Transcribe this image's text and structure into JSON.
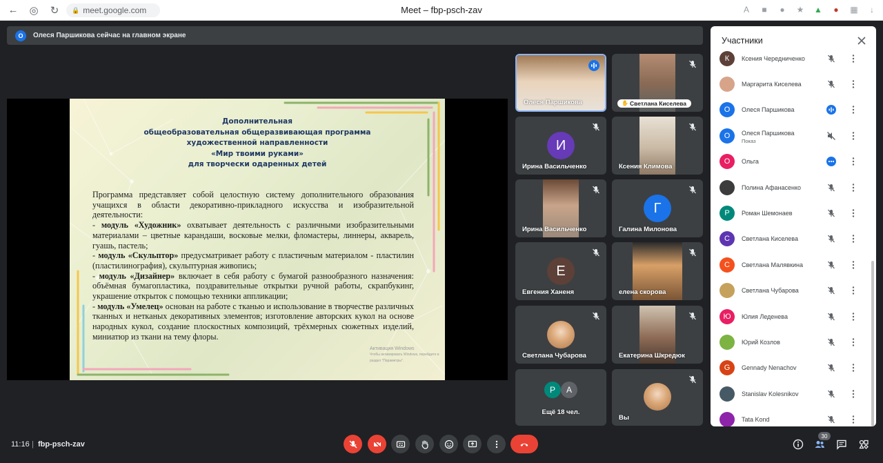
{
  "browser": {
    "url": "meet.google.com",
    "tab_title": "Meet – fbp-psch-zav"
  },
  "banner": {
    "avatar_letter": "О",
    "text": "Олеся Паршикова сейчас на главном экране"
  },
  "slide": {
    "heading_lines": [
      "Дополнительная",
      "общеобразовательная общеразвивающая программа",
      "художественной направленности",
      "«Мир твоими руками»",
      "для творчески одаренных детей"
    ],
    "intro": "Программа представляет собой целостную систему дополнительного образования учащихся в области декоративно-прикладного искусства и изобразительной деятельности:",
    "modules": [
      {
        "lead": "- ",
        "title": "модуль «Художник»",
        "text": " охватывает деятельность с различными изобразительными материалами – цветные карандаши, восковые мелки, фломастеры, линнеры, акварель, гуашь, пастель;"
      },
      {
        "lead": "- ",
        "title": "модуль «Скульптор»",
        "text": " предусматривает работу с пластичным материалом - пластилин (пластилинография), скульптурная живопись;"
      },
      {
        "lead": "- ",
        "title": "модуль «Дизайнер»",
        "text": " включает в себя работу с бумагой разнообразного назначения: объёмная бумагопластика, поздравительные открытки ручной работы, скрапбукинг, украшение открыток с помощью техники аппликации;"
      },
      {
        "lead": "- ",
        "title": "модуль «Умелец»",
        "text": " основан на работе с тканью и использование в творчестве различных тканных и нетканых декоративных элементов; изготовление авторских кукол на основе народных кукол, создание плоскостных композиций, трёхмерных сюжетных изделий, миниатюр из ткани на тему флоры."
      }
    ],
    "watermark_title": "Активация Windows",
    "watermark_sub": "Чтобы активировать Windows, перейдите в раздел \"Параметры\"."
  },
  "tiles": [
    {
      "name": "Олеся Паршикова",
      "kind": "photo",
      "active": true,
      "speaking": true
    },
    {
      "name": "Светлана Киселева",
      "kind": "photo",
      "muted": true,
      "pill": true
    },
    {
      "name": "Ирина Васильченко",
      "kind": "avatar",
      "letter": "И",
      "color": "#673ab7",
      "muted": true
    },
    {
      "name": "Ксения Климова",
      "kind": "photo",
      "muted": true
    },
    {
      "name": "Ирина Васильченко",
      "kind": "photo",
      "muted": true
    },
    {
      "name": "Галина Милонова",
      "kind": "avatar",
      "letter": "Г",
      "color": "#1a73e8",
      "muted": true
    },
    {
      "name": "Евгения Ханеня",
      "kind": "avatar",
      "letter": "Е",
      "color": "#5d4037",
      "muted": true
    },
    {
      "name": "елена скорова",
      "kind": "photo",
      "muted": true
    },
    {
      "name": "Светлана Чубарова",
      "kind": "photo-round",
      "muted": true
    },
    {
      "name": "Екатерина Шкредюк",
      "kind": "photo",
      "muted": true
    },
    {
      "name": "Ещё 18 чел.",
      "kind": "more",
      "letters": [
        "Р",
        "А"
      ]
    },
    {
      "name": "Вы",
      "kind": "photo-round",
      "muted": true
    }
  ],
  "panel": {
    "title": "Участники",
    "participants": [
      {
        "name": "Ксения Чередниченко",
        "letter": "К",
        "color": "#5d4037",
        "status": "muted"
      },
      {
        "name": "Маргарита Киселева",
        "letter": "",
        "color": "#d7a48a",
        "status": "muted"
      },
      {
        "name": "Олеся Паршикова",
        "letter": "О",
        "color": "#1a73e8",
        "status": "speaking"
      },
      {
        "name": "Олеся Паршикова",
        "sub": "Показ",
        "letter": "О",
        "color": "#1a73e8",
        "status": "presenting"
      },
      {
        "name": "Ольга",
        "letter": "О",
        "color": "#e91e63",
        "status": "more"
      },
      {
        "name": "Полина Афанасенко",
        "letter": "",
        "color": "#3c3c3c",
        "status": "muted"
      },
      {
        "name": "Роман Шемонаев",
        "letter": "Р",
        "color": "#00897b",
        "status": "muted"
      },
      {
        "name": "Светлана Киселева",
        "letter": "С",
        "color": "#5e35b1",
        "status": "muted"
      },
      {
        "name": "Светлана Малявкина",
        "letter": "С",
        "color": "#f4511e",
        "status": "muted"
      },
      {
        "name": "Светлана Чубарова",
        "letter": "",
        "color": "#c6a15b",
        "status": "muted"
      },
      {
        "name": "Юлия Леденева",
        "letter": "Ю",
        "color": "#e91e63",
        "status": "muted"
      },
      {
        "name": "Юрий Козлов",
        "letter": "",
        "color": "#7cb342",
        "status": "muted"
      },
      {
        "name": "Gennady Nenachov",
        "letter": "G",
        "color": "#d84315",
        "status": "muted"
      },
      {
        "name": "Stanislav Kolesnikov",
        "letter": "",
        "color": "#455a64",
        "status": "muted"
      },
      {
        "name": "Tata Kond",
        "letter": "",
        "color": "#8e24aa",
        "status": "muted"
      }
    ]
  },
  "bottom": {
    "time": "11:16",
    "separator": "|",
    "meeting_code": "fbp-psch-zav",
    "participant_count": "30"
  },
  "colors": {
    "bg": "#202124",
    "tile": "#3c4043",
    "red": "#ea4335",
    "accent": "#8ab4f8"
  }
}
